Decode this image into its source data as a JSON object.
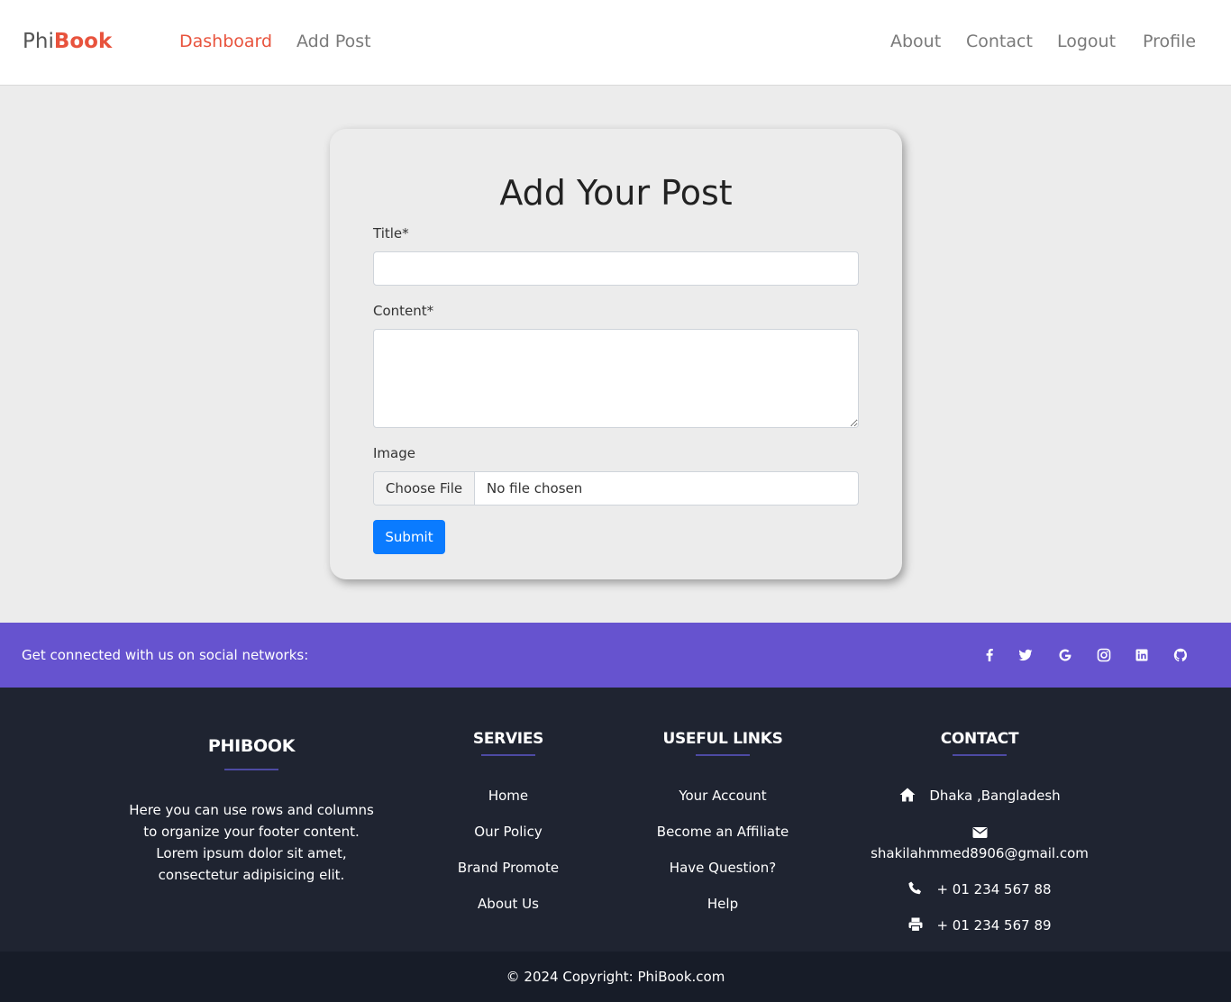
{
  "navbar": {
    "brand_part1": "Phi",
    "brand_part2": "Book",
    "left_links": [
      "Dashboard",
      "Add Post"
    ],
    "right_links": [
      "About",
      "Contact",
      "Logout",
      "Profile"
    ],
    "active_link": "Dashboard",
    "accent_color": "#e8533d"
  },
  "form": {
    "heading": "Add Your Post",
    "title_label": "Title*",
    "title_value": "",
    "content_label": "Content*",
    "content_value": "",
    "image_label": "Image",
    "file_button": "Choose File",
    "file_status": "No file chosen",
    "submit_label": "Submit",
    "submit_color": "#0a7bff"
  },
  "social_bar": {
    "text": "Get connected with us on social networks:",
    "background": "#6653cf",
    "icons": [
      "facebook-icon",
      "twitter-icon",
      "google-icon",
      "instagram-icon",
      "linkedin-icon",
      "github-icon"
    ]
  },
  "footer": {
    "about": {
      "heading": "PHIBOOK",
      "text": "Here you can use rows and columns to organize your footer content. Lorem ipsum dolor sit amet, consectetur adipisicing elit."
    },
    "services": {
      "heading": "SERVIES",
      "items": [
        "Home",
        "Our Policy",
        "Brand Promote",
        "About Us"
      ]
    },
    "useful_links": {
      "heading": "USEFUL LINKS",
      "items": [
        "Your Account",
        "Become an Affiliate",
        "Have Question?",
        "Help"
      ]
    },
    "contact": {
      "heading": "CONTACT",
      "address": "Dhaka ,Bangladesh",
      "email": "shakilahmmed8906@gmail.com",
      "phone": "+ 01 234 567 88",
      "fax": "+ 01 234 567 89"
    },
    "copyright": "© 2024 Copyright: PhiBook.com"
  }
}
